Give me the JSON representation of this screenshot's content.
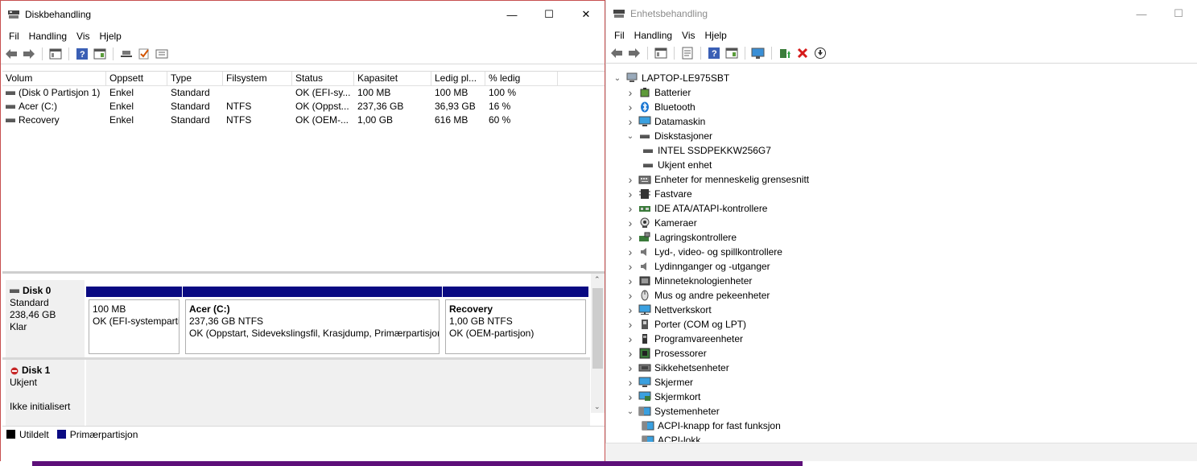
{
  "left_window": {
    "title": "Diskbehandling",
    "menu": [
      "Fil",
      "Handling",
      "Vis",
      "Hjelp"
    ],
    "columns": [
      "Volum",
      "Oppsett",
      "Type",
      "Filsystem",
      "Status",
      "Kapasitet",
      "Ledig pl...",
      "% ledig"
    ],
    "volumes": [
      [
        "(Disk 0 Partisjon 1)",
        "Enkel",
        "Standard",
        "",
        "OK (EFI-sy...",
        "100 MB",
        "100 MB",
        "100 %"
      ],
      [
        "Acer (C:)",
        "Enkel",
        "Standard",
        "NTFS",
        "OK (Oppst...",
        "237,36 GB",
        "36,93 GB",
        "16 %"
      ],
      [
        "Recovery",
        "Enkel",
        "Standard",
        "NTFS",
        "OK (OEM-...",
        "1,00 GB",
        "616 MB",
        "60 %"
      ]
    ],
    "disk0": {
      "name": "Disk 0",
      "type": "Standard",
      "size": "238,46 GB",
      "state": "Klar",
      "partitions": [
        {
          "name": "",
          "line1": "100 MB",
          "line2": "OK (EFI-systempartisjon)"
        },
        {
          "name": "Acer  (C:)",
          "line1": "237,36 GB NTFS",
          "line2": "OK (Oppstart, Sidevekslingsfil, Krasjdump, Primærpartisjon)"
        },
        {
          "name": "Recovery",
          "line1": "1,00 GB NTFS",
          "line2": "OK (OEM-partisjon)"
        }
      ]
    },
    "disk1": {
      "name": "Disk 1",
      "type": "Ukjent",
      "state": "Ikke initialisert"
    },
    "legend": [
      {
        "label": "Utildelt",
        "color": "#000000"
      },
      {
        "label": "Primærpartisjon",
        "color": "#0a0a82"
      }
    ]
  },
  "right_window": {
    "title": "Enhetsbehandling",
    "menu": [
      "Fil",
      "Handling",
      "Vis",
      "Hjelp"
    ],
    "root": "LAPTOP-LE975SBT",
    "tree": [
      {
        "label": "Batterier",
        "icon": "battery-icon",
        "state": "collapsed",
        "level": 1
      },
      {
        "label": "Bluetooth",
        "icon": "bluetooth-icon",
        "state": "collapsed",
        "level": 1
      },
      {
        "label": "Datamaskin",
        "icon": "monitor-icon",
        "state": "collapsed",
        "level": 1
      },
      {
        "label": "Diskstasjoner",
        "icon": "drive-icon",
        "state": "expanded",
        "level": 1
      },
      {
        "label": "INTEL SSDPEKKW256G7",
        "icon": "drive-icon",
        "state": "leaf",
        "level": 2
      },
      {
        "label": "Ukjent enhet",
        "icon": "drive-icon",
        "state": "leaf",
        "level": 2
      },
      {
        "label": "Enheter for menneskelig grensesnitt",
        "icon": "hid-icon",
        "state": "collapsed",
        "level": 1
      },
      {
        "label": "Fastvare",
        "icon": "chip-icon",
        "state": "collapsed",
        "level": 1
      },
      {
        "label": "IDE ATA/ATAPI-kontrollere",
        "icon": "controller-icon",
        "state": "collapsed",
        "level": 1
      },
      {
        "label": "Kameraer",
        "icon": "camera-icon",
        "state": "collapsed",
        "level": 1
      },
      {
        "label": "Lagringskontrollere",
        "icon": "storage-controller-icon",
        "state": "collapsed",
        "level": 1
      },
      {
        "label": "Lyd-, video- og spillkontrollere",
        "icon": "speaker-icon",
        "state": "collapsed",
        "level": 1
      },
      {
        "label": "Lydinnganger og -utganger",
        "icon": "speaker-icon",
        "state": "collapsed",
        "level": 1
      },
      {
        "label": "Minneteknologienheter",
        "icon": "memory-icon",
        "state": "collapsed",
        "level": 1
      },
      {
        "label": "Mus og andre pekeenheter",
        "icon": "mouse-icon",
        "state": "collapsed",
        "level": 1
      },
      {
        "label": "Nettverkskort",
        "icon": "network-icon",
        "state": "collapsed",
        "level": 1
      },
      {
        "label": "Porter (COM og LPT)",
        "icon": "port-icon",
        "state": "collapsed",
        "level": 1
      },
      {
        "label": "Programvareenheter",
        "icon": "software-device-icon",
        "state": "collapsed",
        "level": 1
      },
      {
        "label": "Prosessorer",
        "icon": "processor-icon",
        "state": "collapsed",
        "level": 1
      },
      {
        "label": "Sikkehetsenheter",
        "icon": "security-device-icon",
        "state": "collapsed",
        "level": 1
      },
      {
        "label": "Skjermer",
        "icon": "monitor-icon",
        "state": "collapsed",
        "level": 1
      },
      {
        "label": "Skjermkort",
        "icon": "display-adapter-icon",
        "state": "collapsed",
        "level": 1
      },
      {
        "label": "Systemenheter",
        "icon": "system-device-icon",
        "state": "expanded",
        "level": 1
      },
      {
        "label": "ACPI-knapp for fast funksjon",
        "icon": "system-device-icon",
        "state": "leaf",
        "level": 2
      },
      {
        "label": "ACPI-lokk",
        "icon": "system-device-icon",
        "state": "leaf",
        "level": 2
      }
    ]
  }
}
